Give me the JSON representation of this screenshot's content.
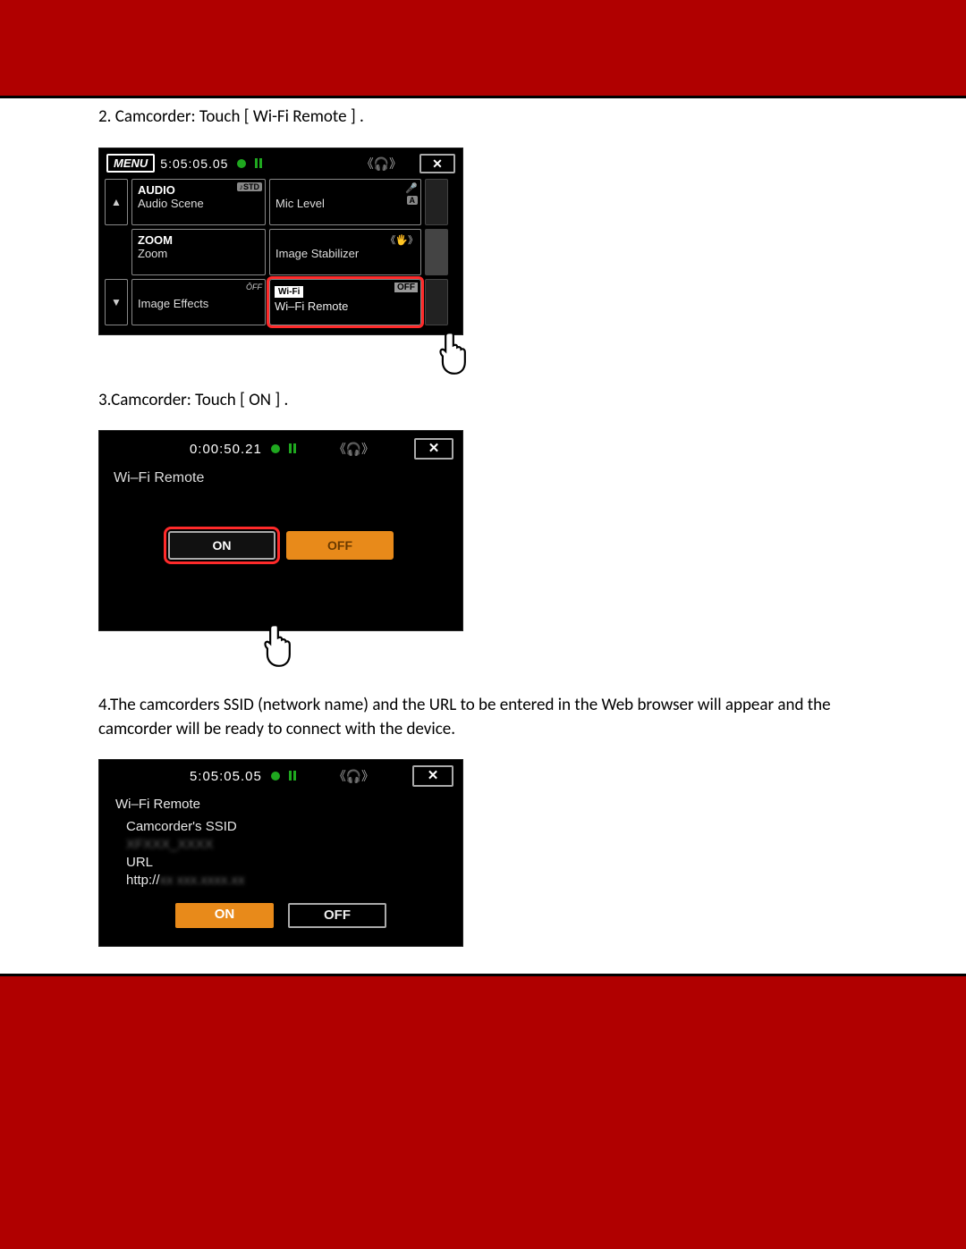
{
  "steps": {
    "s2": "2. Camcorder: Touch [ Wi-Fi Remote ] .",
    "s3": "3.Camcorder: Touch [ ON ] .",
    "s4": "4.The camcorders SSID (network name) and the URL to be entered in the Web browser will appear and the camcorder will be ready to connect with the device."
  },
  "screen1": {
    "menu": "MENU",
    "time": "5:05:05.05",
    "close": "✕",
    "cells": {
      "audio_h": "AUDIO",
      "audio_s": "Audio Scene",
      "audio_badge": "♪STD",
      "mic_s": "Mic Level",
      "mic_badge": "A",
      "zoom_h": "ZOOM",
      "zoom_s": "Zoom",
      "stab_s": "Image Stabilizer",
      "fx_s": "Image Effects",
      "fx_badge": "ŌFF",
      "wifi_tag": "Wi-Fi",
      "wifi_off": "OFF",
      "wifi_s": "Wi–Fi Remote"
    }
  },
  "screen2": {
    "time": "0:00:50.21",
    "close": "✕",
    "title": "Wi–Fi Remote",
    "on": "ON",
    "off": "OFF"
  },
  "screen3": {
    "time": "5:05:05.05",
    "close": "✕",
    "title": "Wi–Fi Remote",
    "ssid_label": "Camcorder's SSID",
    "ssid_value": "XFXXX_XXXX",
    "url_label": "URL",
    "url_prefix": "http://",
    "url_value": "xx xxx.xxxx.xx",
    "on": "ON",
    "off": "OFF"
  },
  "icons": {
    "headphone_wave": "《 🎧 》",
    "mic": "🎤",
    "stab_waves": "《🖐》"
  }
}
